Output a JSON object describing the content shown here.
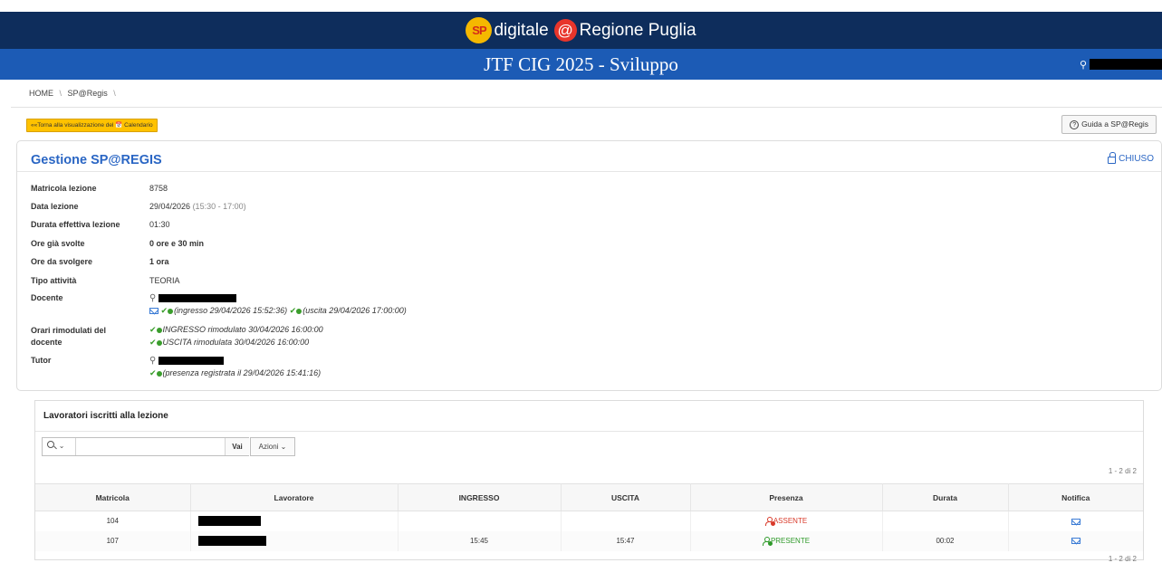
{
  "header": {
    "brand_sp": "SP",
    "brand_left": "digitale",
    "brand_at": "@",
    "brand_right": "Regione Puglia",
    "app_title": "JTF CIG 2025 - Sviluppo"
  },
  "breadcrumb": [
    "HOME",
    "SP@Regis"
  ],
  "buttons": {
    "back_calendar": "««Torna alla visualizzazione del 📅 Calendario",
    "guide": "Guida a SP@Regis",
    "guide_icon": "?"
  },
  "card": {
    "title": "Gestione SP@REGIS",
    "status": "CHIUSO",
    "fields": {
      "matricola_label": "Matricola lezione",
      "matricola_value": "8758",
      "data_label": "Data lezione",
      "data_value": "29/04/2026",
      "data_time": "(15:30 - 17:00)",
      "durata_label": "Durata effettiva lezione",
      "durata_value": "01:30",
      "ore_svolte_label": "Ore già svolte",
      "ore_svolte_value": "0 ore e 30 min",
      "ore_svolgere_label": "Ore da svolgere",
      "ore_svolgere_value": "1 ora",
      "tipo_label": "Tipo attività",
      "tipo_value": "TEORIA",
      "docente_label": "Docente",
      "docente_ingresso": "(ingresso 29/04/2026 15:52:36)",
      "docente_uscita": "(uscita 29/04/2026 17:00:00)",
      "orari_label": "Orari rimodulati del docente",
      "orari_ingresso": "INGRESSO rimodulato 30/04/2026 16:00:00",
      "orari_uscita": "USCITA rimodulata 30/04/2026 16:00:00",
      "tutor_label": "Tutor",
      "tutor_presenza": "(presenza registrata il 29/04/2026 15:41:16)"
    }
  },
  "workers": {
    "title": "Lavoratori iscritti alla lezione",
    "search_placeholder": "",
    "vai": "Vai",
    "azioni": "Azioni ⌄",
    "pagination": "1 - 2 di 2",
    "columns": [
      "Matricola",
      "Lavoratore",
      "INGRESSO",
      "USCITA",
      "Presenza",
      "Durata",
      "Notifica"
    ],
    "rows": [
      {
        "matricola": "104",
        "ingresso": "",
        "uscita": "",
        "presenza": "ASSENTE",
        "durata": ""
      },
      {
        "matricola": "107",
        "ingresso": "15:45",
        "uscita": "15:47",
        "presenza": "PRESENTE",
        "durata": "00:02"
      }
    ]
  },
  "colors": {
    "top_band": "#0e2d5c",
    "title_band": "#1c5bb5",
    "accent": "#2a66c4",
    "calendar_button": "#ffc200",
    "present": "#2f9a2a",
    "absent": "#d93a2a"
  }
}
